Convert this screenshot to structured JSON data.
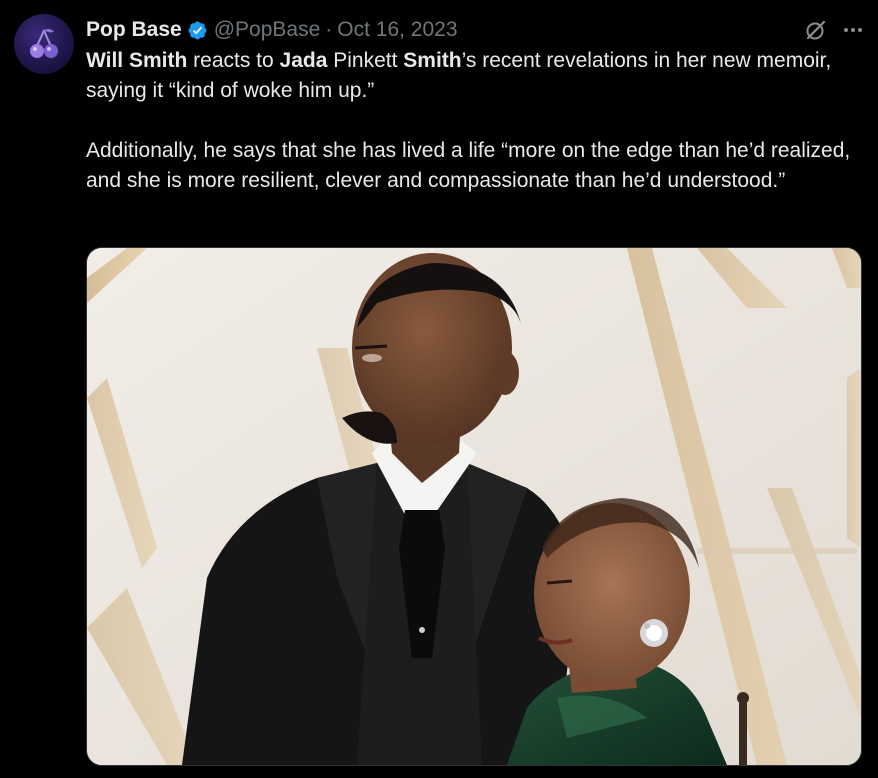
{
  "tweet": {
    "author": {
      "name": "Pop Base",
      "handle": "@PopBase",
      "avatar_icon": "cherry-logo-icon",
      "verified_icon": "verified-badge-icon",
      "verified_color": "#1d9bf0"
    },
    "separator": "·",
    "date": "Oct 16, 2023",
    "actions": {
      "grok_icon": "grok-icon",
      "more_icon": "more-icon",
      "more_label": "···"
    },
    "paragraph1": {
      "p1": "Will Smith",
      "p2": " reacts to ",
      "p3": "Jada",
      "p4": " Pinkett ",
      "p5": "Smith",
      "p6": "’s recent revelations in her new memoir, saying it “kind of woke him up.”"
    },
    "paragraph2": "Additionally, he says that she has lived a life “more on the edge than he’d realized, and she is more resilient, clever and compassionate than he’d understood.”",
    "media": {
      "type": "photo"
    }
  },
  "colors": {
    "background": "#000000",
    "text": "#e7e9ea",
    "secondary": "#71767b",
    "accent": "#1d9bf0",
    "border": "#2f3336"
  }
}
